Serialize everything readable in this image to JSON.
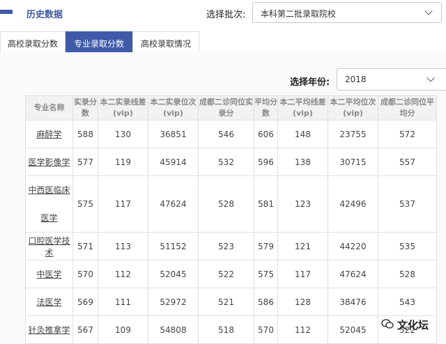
{
  "header": {
    "title": "历史数据"
  },
  "batch": {
    "label": "选择批次:",
    "value": "本科第二批录取院校"
  },
  "tabs": [
    {
      "label": "高校录取分数"
    },
    {
      "label": "专业录取分数"
    },
    {
      "label": "高校录取情况"
    }
  ],
  "year": {
    "label": "选择年份:",
    "value": "2018"
  },
  "table": {
    "headers": [
      "专业名称",
      "实录分数",
      "本二实录线差(vip)",
      "本二实录位次(vip)",
      "成都二诊同位实录分",
      "平均分数",
      "本二平均线差(vip)",
      "本二平均位次(vip)",
      "成都二诊同位平均分"
    ],
    "rows": [
      [
        "麻醉学",
        "588",
        "130",
        "36851",
        "546",
        "606",
        "148",
        "23755",
        "572"
      ],
      [
        "医学影像学",
        "577",
        "119",
        "45914",
        "532",
        "596",
        "138",
        "30715",
        "557"
      ],
      [
        "中西医临床医学",
        "575",
        "117",
        "47624",
        "528",
        "581",
        "123",
        "42496",
        "537"
      ],
      [
        "口腔医学技术",
        "571",
        "113",
        "51152",
        "523",
        "579",
        "121",
        "44220",
        "535"
      ],
      [
        "中医学",
        "570",
        "112",
        "52045",
        "522",
        "575",
        "117",
        "47624",
        "528"
      ],
      [
        "法医学",
        "569",
        "111",
        "52972",
        "521",
        "586",
        "128",
        "38476",
        "543"
      ],
      [
        "针灸推拿学",
        "567",
        "109",
        "54808",
        "518",
        "570",
        "112",
        "52045",
        "522"
      ]
    ]
  },
  "watermark": {
    "text": "文化坛",
    "icon": "wechat-icon"
  }
}
